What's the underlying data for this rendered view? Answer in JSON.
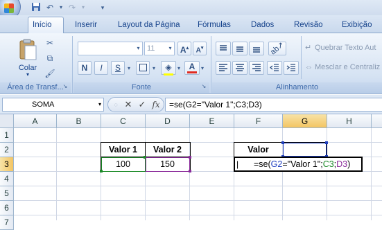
{
  "quick_access": {
    "save_icon": "save-icon",
    "undo_icon": "undo-icon",
    "redo_icon": "redo-icon"
  },
  "tabs": [
    {
      "label": "Início",
      "active": true
    },
    {
      "label": "Inserir"
    },
    {
      "label": "Layout da Página"
    },
    {
      "label": "Fórmulas"
    },
    {
      "label": "Dados"
    },
    {
      "label": "Revisão"
    },
    {
      "label": "Exibição"
    }
  ],
  "ribbon": {
    "clipboard": {
      "paste_label": "Colar",
      "group_label": "Área de Transf..."
    },
    "font": {
      "font_name": "",
      "font_size": "11",
      "bold": "N",
      "italic": "I",
      "underline": "S",
      "grow": "A",
      "shrink": "A",
      "font_color": "A",
      "group_label": "Fonte"
    },
    "alignment": {
      "wrap_text": "Quebrar Texto Aut",
      "merge_center": "Mesclar e Centraliz",
      "group_label": "Alinhamento"
    }
  },
  "formula_bar": {
    "name_box": "SOMA",
    "cancel": "✕",
    "enter": "✓",
    "fx": "fx",
    "formula": "=se(G2=\"Valor 1\";C3;D3)"
  },
  "sheet": {
    "columns": [
      "A",
      "B",
      "C",
      "D",
      "E",
      "F",
      "G",
      "H"
    ],
    "rows": [
      "1",
      "2",
      "3",
      "4",
      "5",
      "6",
      "7"
    ],
    "cells": {
      "C2": "Valor 1",
      "D2": "Valor 2",
      "C3": "100",
      "D3": "150",
      "F2": "Valor",
      "F3_prefix": "=se(",
      "F3_ref1": "G2",
      "F3_mid": "=\"Valor 1\";",
      "F3_ref2": "C3",
      "F3_sep": ";",
      "F3_ref3": "D3",
      "F3_suffix": ")"
    },
    "ref_colors": {
      "G2": "#1f3fbf",
      "C3": "#1c8a28",
      "D3": "#8a2a9a"
    }
  }
}
